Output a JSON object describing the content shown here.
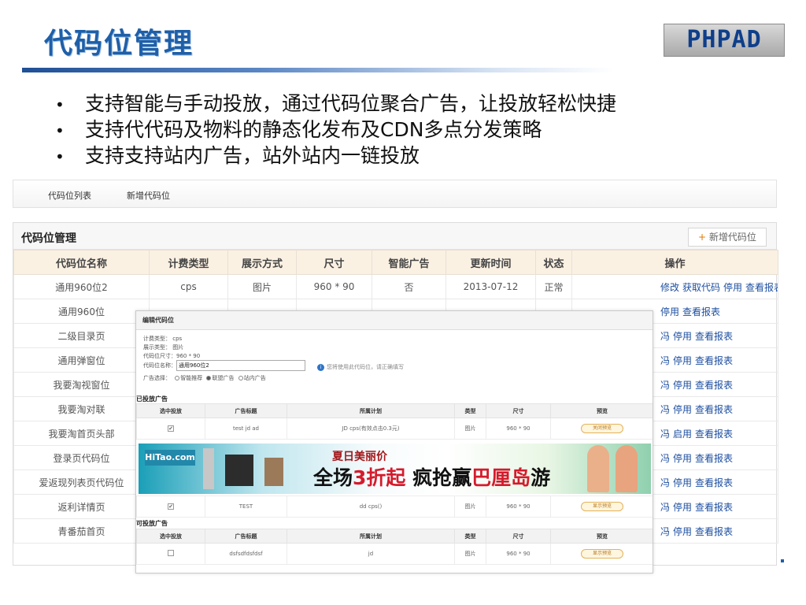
{
  "slide": {
    "title": "代码位管理",
    "logo": "PHPAD",
    "bullets": [
      "支持智能与手动投放，通过代码位聚合广告，让投放轻松快捷",
      "支持代代码及物料的静态化发布及CDN多点分发策略",
      "支持支持站内广告，站外站内一链投放"
    ]
  },
  "admin_nav": {
    "items": [
      "代码位列表",
      "新增代码位"
    ]
  },
  "panel": {
    "title": "代码位管理",
    "add_button": "新增代码位",
    "columns": [
      "代码位名称",
      "计费类型",
      "展示方式",
      "尺寸",
      "智能广告",
      "更新时间",
      "状态",
      "操作"
    ],
    "rows": [
      {
        "name": "通用960位2",
        "billing": "cps",
        "display": "图片",
        "size": "960 * 90",
        "smart": "否",
        "updated": "2013-07-12",
        "status": "正常",
        "ops": [
          "修改",
          "获取代码",
          "停用",
          "查看报表"
        ]
      },
      {
        "name": "通用960位",
        "billing": "",
        "display": "",
        "size": "",
        "smart": "",
        "updated": "",
        "status": "",
        "ops": [
          "",
          "",
          "停用",
          "查看报表"
        ]
      },
      {
        "name": "二级目录页",
        "ops": [
          "停用",
          "查看报表"
        ]
      },
      {
        "name": "通用弹窗位",
        "ops": [
          "停用",
          "查看报表"
        ]
      },
      {
        "name": "我要淘视窗位",
        "ops": [
          "停用",
          "查看报表"
        ]
      },
      {
        "name": "我要淘对联",
        "ops": [
          "停用",
          "查看报表"
        ]
      },
      {
        "name": "我要淘首页头部",
        "ops": [
          "启用",
          "查看报表"
        ]
      },
      {
        "name": "登录页代码位",
        "ops": [
          "停用",
          "查看报表"
        ]
      },
      {
        "name": "爱返现列表页代码位",
        "ops": [
          "停用",
          "查看报表"
        ]
      },
      {
        "name": "返利详情页",
        "ops": [
          "停用",
          "查看报表"
        ]
      },
      {
        "name": "青番茄首页",
        "ops": [
          "停用",
          "查看报表"
        ]
      }
    ],
    "ops_clipped_prefix": "冯"
  },
  "dialog": {
    "title": "编辑代码位",
    "form": {
      "billing_label": "计费类型：",
      "billing_value": "cps",
      "display_label": "展示类型：",
      "display_value": "图片",
      "size_label": "代码位尺寸：",
      "size_value": "960 * 90",
      "name_label": "代码位名称：",
      "name_value": "通用960位2",
      "hint": "您将使用此代码位，请正确填写",
      "ad_select_label": "广告选择：",
      "ad_options": [
        "智能推荐",
        "联盟广告",
        "站内广告"
      ],
      "ad_selected": "联盟广告"
    },
    "placed_section": "已投放广告",
    "available_section": "可投放广告",
    "sub_columns": [
      "选中投放",
      "广告标题",
      "所属计划",
      "类型",
      "尺寸",
      "预览"
    ],
    "placed_rows": [
      {
        "title": "test jd ad",
        "plan": "JD cps(有效点击0.3元)",
        "type": "图片",
        "size": "960 * 90",
        "preview": "关闭预览",
        "checked": true
      },
      {
        "title": "TEST",
        "plan": "dd cps()",
        "type": "图片",
        "size": "960 * 90",
        "preview": "显示预览",
        "checked": true
      }
    ],
    "available_rows": [
      {
        "title": "dsfsdfdsfdsf",
        "plan": "jd",
        "type": "图片",
        "size": "960 * 90",
        "preview": "显示预览",
        "checked": false
      }
    ],
    "banner": {
      "brand": "HiTao.com",
      "small_text": "夏日美丽价",
      "big_text_a": "全场",
      "big_text_b": "3折起",
      "big_text_c": " 疯抢赢",
      "big_text_d": "巴厘岛",
      "big_text_e": "游"
    }
  },
  "colors": {
    "title_blue": "#1f5fa8",
    "status_ok": "#2aa52a",
    "link_blue": "#1e4fa0",
    "header_bg": "#fbf1e3"
  }
}
